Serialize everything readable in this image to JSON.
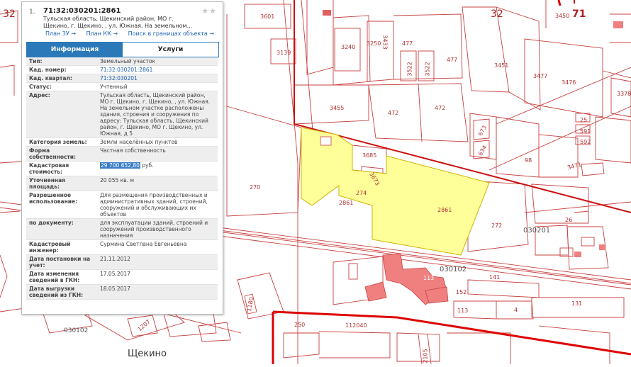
{
  "map": {
    "labels": {
      "l3601": "3601",
      "l3139": "3139",
      "l3240": "3240",
      "l3250": "3250",
      "l3433": "3433",
      "l477a": "477",
      "l477b": "477",
      "l3522a": "3522",
      "l3522b": "3522",
      "l3451": "3451",
      "l3477": "3477",
      "l3476": "3476",
      "l32": "32",
      "l3450": "3450",
      "l71": "71",
      "l3378": "3378",
      "l3455": "3455",
      "l472a": "472",
      "l472b": "472",
      "l673": "673",
      "l634": "634",
      "l25": "25",
      "l591": "591",
      "l592": "592",
      "l98": "98",
      "l3471": "3471",
      "l3685": "3685",
      "l3673": "3673",
      "l270": "270",
      "l274": "274",
      "l2861a": "2861",
      "l2861b": "2861",
      "l272": "272",
      "l26": "26",
      "l030201": "030201",
      "l030102": "030102",
      "l141": "141",
      "l152": "152",
      "l113a": "113",
      "l113b": "113",
      "l4": "4",
      "l131": "131",
      "l250": "250",
      "l112040": "112040",
      "l030102b": "030102",
      "l2105": "2105",
      "l1180": "1180",
      "l1207": "1207",
      "lcity": "Щекино",
      "l32left": "32"
    }
  },
  "panel": {
    "number": "1.",
    "cadastral_number": "71:32:030201:2861",
    "address_short": "Тульская область, Щекинский район, МО г. Щекино, г. Щекино, , ул. Южная. На земельном...",
    "links": [
      "План ЗУ →",
      "План КК →",
      "Поиск в границах объекта →"
    ],
    "tabs": [
      "Информация",
      "Услуги"
    ],
    "rows": [
      {
        "k": "Тип:",
        "v": "Земельный участок"
      },
      {
        "k": "Кад. номер:",
        "v": "71:32:030201:2861"
      },
      {
        "k": "Кад. квартал:",
        "v": "71:32:030201"
      },
      {
        "k": "Статус:",
        "v": "Учтенный"
      },
      {
        "k": "Адрес:",
        "v": "Тульская область, Щекинский район, МО г. Щекино, г. Щекино, , ул. Южная. На земельном участке расположены здания, строения и сооружения по адресу: Тульская область, Щекинский район, г. Щекино, МО г. Щекино, ул. Южная, д 5"
      },
      {
        "k": "Категория земель:",
        "v": "Земли населённых пунктов"
      },
      {
        "k": "Форма собственности:",
        "v": "Частная собственность"
      },
      {
        "k": "Кадастровая стоимость:",
        "v_value": "29 700 652,80",
        "v_unit": " руб."
      },
      {
        "k": "Уточненная площадь:",
        "v": "20 055 кв. м"
      },
      {
        "k": "Разрешенное использование:",
        "v": "Для размещения производственных и административных зданий, строений, сооружений и обслуживающих их объектов"
      },
      {
        "k": "по документу:",
        "v": "для эксплуатации зданий, строений и сооружений производственного назначения"
      },
      {
        "k": "Кадастровый инженер:",
        "v": "Сурмина Светлана Евгеньевна"
      },
      {
        "k": "Дата постановки на учет:",
        "v": "21.11.2012"
      },
      {
        "k": "Дата изменения сведений в ГКН:",
        "v": "17.05.2017"
      },
      {
        "k": "Дата выгрузки сведений из ГКН:",
        "v": "18.05.2017"
      }
    ]
  },
  "colors": {
    "parcel_line": "#c94040",
    "selected_fill": "#ffff99",
    "building_fill": "#f08080",
    "boundary": "#d40000",
    "tab_active": "#2b79b8",
    "link": "#1a5fb4"
  }
}
